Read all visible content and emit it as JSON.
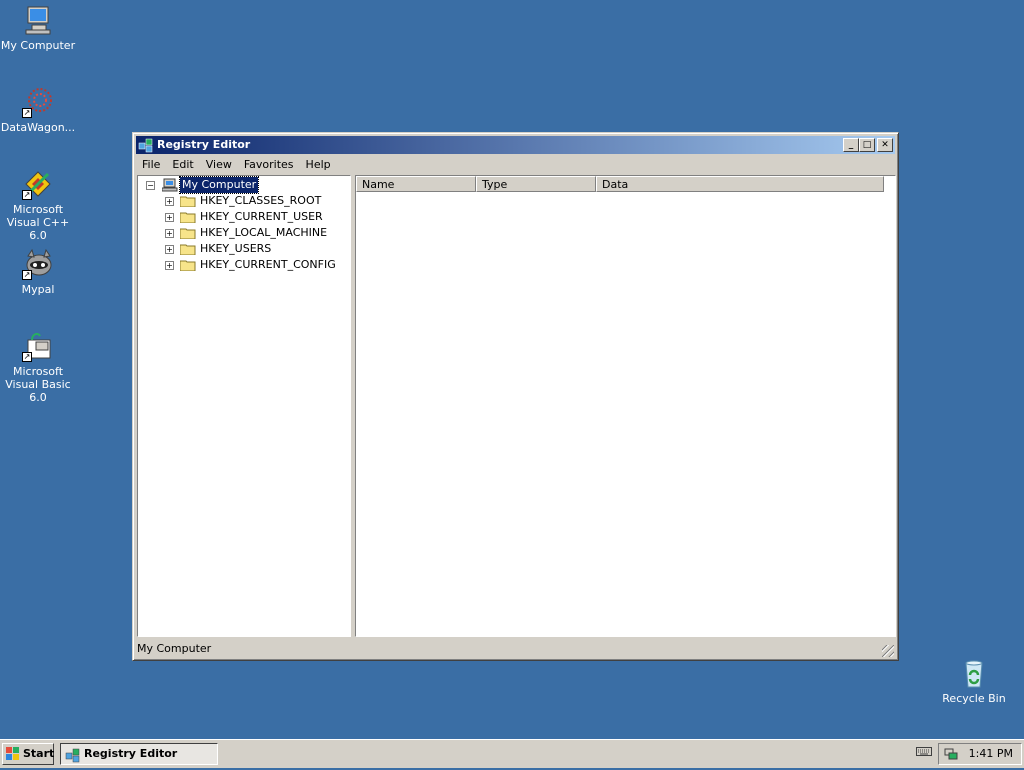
{
  "desktop": {
    "icons": [
      {
        "label": "My Computer",
        "icon": "my-computer-icon"
      },
      {
        "label": "DataWagon...",
        "icon": "datawagon-icon"
      },
      {
        "label": "Microsoft Visual C++ 6.0",
        "icon": "visual-cpp-icon"
      },
      {
        "label": "Mypal",
        "icon": "mypal-icon"
      },
      {
        "label": "Microsoft Visual Basic 6.0",
        "icon": "visual-basic-icon"
      },
      {
        "label": "Recycle Bin",
        "icon": "recycle-bin-icon"
      }
    ],
    "background_color": "#3a6ea5"
  },
  "window": {
    "title": "Registry Editor",
    "menu": [
      "File",
      "Edit",
      "View",
      "Favorites",
      "Help"
    ],
    "tree": {
      "root": "My Computer",
      "keys": [
        "HKEY_CLASSES_ROOT",
        "HKEY_CURRENT_USER",
        "HKEY_LOCAL_MACHINE",
        "HKEY_USERS",
        "HKEY_CURRENT_CONFIG"
      ]
    },
    "columns": [
      "Name",
      "Type",
      "Data"
    ],
    "status": "My Computer",
    "title_color": "#0a246a"
  },
  "taskbar": {
    "start_label": "Start",
    "task_label": "Registry Editor",
    "clock": "1:41 PM"
  }
}
